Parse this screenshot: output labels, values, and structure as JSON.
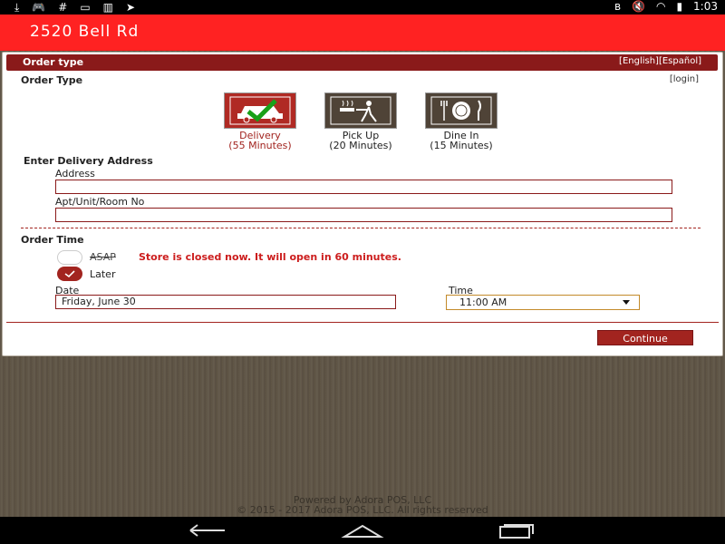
{
  "status_bar": {
    "time": "1:03",
    "left_icons": [
      "download-icon",
      "gamepad-icon",
      "hashtag-icon",
      "card-icon",
      "barcode-icon",
      "send-icon"
    ],
    "right_icons": [
      "bluetooth-icon",
      "mute-icon",
      "wifi-icon",
      "battery-icon"
    ]
  },
  "app_bar": {
    "title": "2520 Bell Rd"
  },
  "order_card": {
    "header_title": "Order type",
    "language_links": "[English][Español]",
    "login_link": "[login]",
    "order_type_label": "Order Type",
    "options": [
      {
        "label": "Delivery",
        "time": "(55 Minutes)",
        "icon": "car-check-icon",
        "selected": true
      },
      {
        "label": "Pick Up",
        "time": "(20 Minutes)",
        "icon": "walking-takeout-icon",
        "selected": false
      },
      {
        "label": "Dine In",
        "time": "(15 Minutes)",
        "icon": "plate-cutlery-icon",
        "selected": false
      }
    ],
    "delivery_address_label": "Enter Delivery Address",
    "address_label": "Address",
    "address_value": "",
    "unit_label": "Apt/Unit/Room No",
    "unit_value": "",
    "order_time_label": "Order Time",
    "asap_label": "ASAP",
    "asap_message": "Store is closed now. It will open in 60 minutes.",
    "later_label": "Later",
    "date_label": "Date",
    "date_value": "Friday, June 30",
    "time_label": "Time",
    "time_value": "11:00 AM",
    "continue_label": "Continue"
  },
  "footer": {
    "line1": "Powered by Adora POS, LLC",
    "line2": "© 2015 - 2017 Adora POS, LLC. All rights reserved"
  },
  "colors": {
    "accent_red": "#ff2222",
    "dark_red": "#8a1a1a",
    "button_red": "#a2241f"
  }
}
